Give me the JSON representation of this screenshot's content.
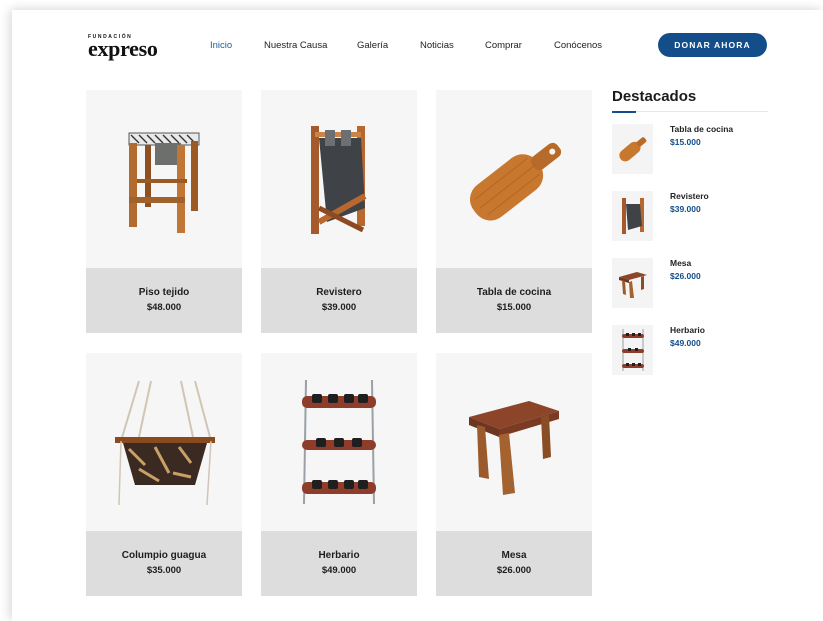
{
  "header": {
    "logo_small": "FUNDACIÓN",
    "logo_main": "expreso",
    "nav": [
      "Inicio",
      "Nuestra Causa",
      "Galería",
      "Noticias",
      "Comprar",
      "Conócenos"
    ],
    "active_nav": "Inicio",
    "donate_label": "DONAR AHORA"
  },
  "products": [
    {
      "name": "Piso tejido",
      "price": "$48.000",
      "icon": "woven-stool"
    },
    {
      "name": "Revistero",
      "price": "$39.000",
      "icon": "magazine-rack"
    },
    {
      "name": "Tabla de cocina",
      "price": "$15.000",
      "icon": "cutting-board"
    },
    {
      "name": "Columpio guagua",
      "price": "$35.000",
      "icon": "baby-swing"
    },
    {
      "name": "Herbario",
      "price": "$49.000",
      "icon": "hanging-planter"
    },
    {
      "name": "Mesa",
      "price": "$26.000",
      "icon": "wood-table"
    }
  ],
  "sidebar": {
    "title": "Destacados",
    "items": [
      {
        "name": "Tabla de cocina",
        "price": "$15.000",
        "icon": "cutting-board"
      },
      {
        "name": "Revistero",
        "price": "$39.000",
        "icon": "magazine-rack"
      },
      {
        "name": "Mesa",
        "price": "$26.000",
        "icon": "wood-table"
      },
      {
        "name": "Herbario",
        "price": "$49.000",
        "icon": "hanging-planter"
      }
    ]
  },
  "colors": {
    "accent": "#134e8a",
    "card_bg": "#f6f6f6",
    "card_info_bg": "#dddddd",
    "wood": "#a0522d"
  }
}
